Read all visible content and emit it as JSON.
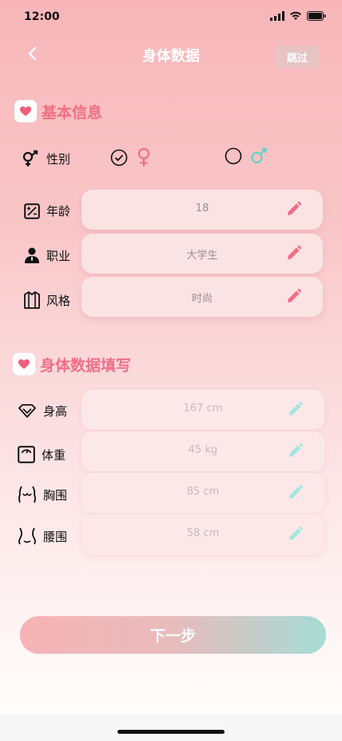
{
  "status": {
    "time": "12:00"
  },
  "nav": {
    "title": "身体数据",
    "skip_label": "跳过"
  },
  "basic": {
    "title": "基本信息",
    "gender": {
      "label": "性别",
      "female_selected": true
    },
    "rows": [
      {
        "label": "年龄",
        "value": "18",
        "icon": "age-icon"
      },
      {
        "label": "职业",
        "value": "大学生",
        "icon": "occupation-icon"
      },
      {
        "label": "风格",
        "value": "时尚",
        "icon": "style-icon"
      }
    ]
  },
  "body": {
    "title": "身体数据填写",
    "rows": [
      {
        "label": "身高",
        "value": "167 cm",
        "icon": "height-icon"
      },
      {
        "label": "体重",
        "value": "45 kg",
        "icon": "weight-icon"
      },
      {
        "label": "胸围",
        "value": "85 cm",
        "icon": "chest-icon"
      },
      {
        "label": "腰围",
        "value": "58 cm",
        "icon": "waist-icon"
      }
    ]
  },
  "next_label": "下一步",
  "colors": {
    "accent_pink": "#ef6f86",
    "accent_teal": "#8ee0d6"
  }
}
